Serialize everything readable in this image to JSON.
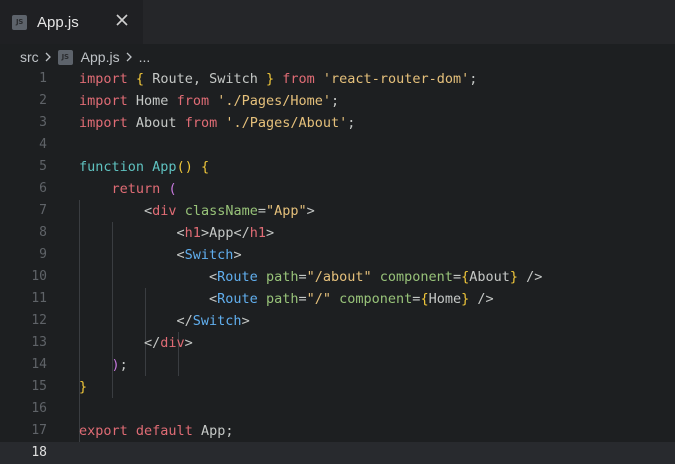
{
  "tab": {
    "title": "App.js",
    "badge": "JS"
  },
  "breadcrumb": {
    "folder": "src",
    "file": "App.js",
    "tail": "..."
  },
  "editor": {
    "current_line": 18,
    "lines": [
      {
        "n": "1",
        "tokens": [
          [
            "kw",
            "import"
          ],
          [
            "punct",
            " "
          ],
          [
            "br",
            "{"
          ],
          [
            "ident",
            " Route, Switch "
          ],
          [
            "br",
            "}"
          ],
          [
            "punct",
            " "
          ],
          [
            "kw",
            "from"
          ],
          [
            "punct",
            " "
          ],
          [
            "str",
            "'react-router-dom'"
          ],
          [
            "punct",
            ";"
          ]
        ]
      },
      {
        "n": "2",
        "tokens": [
          [
            "kw",
            "import"
          ],
          [
            "ident",
            " Home "
          ],
          [
            "kw",
            "from"
          ],
          [
            "punct",
            " "
          ],
          [
            "str",
            "'./Pages/Home'"
          ],
          [
            "punct",
            ";"
          ]
        ]
      },
      {
        "n": "3",
        "tokens": [
          [
            "kw",
            "import"
          ],
          [
            "ident",
            " About "
          ],
          [
            "kw",
            "from"
          ],
          [
            "punct",
            " "
          ],
          [
            "str",
            "'./Pages/About'"
          ],
          [
            "punct",
            ";"
          ]
        ]
      },
      {
        "n": "4",
        "tokens": []
      },
      {
        "n": "5",
        "tokens": [
          [
            "fn",
            "function"
          ],
          [
            "punct",
            " "
          ],
          [
            "fn",
            "App"
          ],
          [
            "br",
            "()"
          ],
          [
            "punct",
            " "
          ],
          [
            "br",
            "{"
          ]
        ]
      },
      {
        "n": "6",
        "tokens": [
          [
            "punct",
            "    "
          ],
          [
            "kw",
            "return"
          ],
          [
            "punct",
            " "
          ],
          [
            "br2",
            "("
          ]
        ]
      },
      {
        "n": "7",
        "tokens": [
          [
            "punct",
            "        <"
          ],
          [
            "tag",
            "div"
          ],
          [
            "punct",
            " "
          ],
          [
            "attr",
            "className"
          ],
          [
            "punct",
            "="
          ],
          [
            "str",
            "\"App\""
          ],
          [
            "punct",
            ">"
          ]
        ]
      },
      {
        "n": "8",
        "tokens": [
          [
            "punct",
            "            <"
          ],
          [
            "tag",
            "h1"
          ],
          [
            "punct",
            ">"
          ],
          [
            "ident",
            "App"
          ],
          [
            "punct",
            "</"
          ],
          [
            "tag",
            "h1"
          ],
          [
            "punct",
            ">"
          ]
        ]
      },
      {
        "n": "9",
        "tokens": [
          [
            "punct",
            "            <"
          ],
          [
            "cmp",
            "Switch"
          ],
          [
            "punct",
            ">"
          ]
        ]
      },
      {
        "n": "10",
        "tokens": [
          [
            "punct",
            "                <"
          ],
          [
            "cmp",
            "Route"
          ],
          [
            "punct",
            " "
          ],
          [
            "attr",
            "path"
          ],
          [
            "punct",
            "="
          ],
          [
            "str",
            "\"/about\""
          ],
          [
            "punct",
            " "
          ],
          [
            "attr",
            "component"
          ],
          [
            "punct",
            "="
          ],
          [
            "br",
            "{"
          ],
          [
            "ident",
            "About"
          ],
          [
            "br",
            "}"
          ],
          [
            "punct",
            " />"
          ]
        ]
      },
      {
        "n": "11",
        "tokens": [
          [
            "punct",
            "                <"
          ],
          [
            "cmp",
            "Route"
          ],
          [
            "punct",
            " "
          ],
          [
            "attr",
            "path"
          ],
          [
            "punct",
            "="
          ],
          [
            "str",
            "\"/\""
          ],
          [
            "punct",
            " "
          ],
          [
            "attr",
            "component"
          ],
          [
            "punct",
            "="
          ],
          [
            "br",
            "{"
          ],
          [
            "ident",
            "Home"
          ],
          [
            "br",
            "}"
          ],
          [
            "punct",
            " />"
          ]
        ]
      },
      {
        "n": "12",
        "tokens": [
          [
            "punct",
            "            </"
          ],
          [
            "cmp",
            "Switch"
          ],
          [
            "punct",
            ">"
          ]
        ]
      },
      {
        "n": "13",
        "tokens": [
          [
            "punct",
            "        </"
          ],
          [
            "tag",
            "div"
          ],
          [
            "punct",
            ">"
          ]
        ]
      },
      {
        "n": "14",
        "tokens": [
          [
            "punct",
            "    "
          ],
          [
            "br2",
            ")"
          ],
          [
            "punct",
            ";"
          ]
        ]
      },
      {
        "n": "15",
        "tokens": [
          [
            "br",
            "}"
          ]
        ]
      },
      {
        "n": "16",
        "tokens": []
      },
      {
        "n": "17",
        "tokens": [
          [
            "kw",
            "export"
          ],
          [
            "punct",
            " "
          ],
          [
            "kw",
            "default"
          ],
          [
            "ident",
            " App"
          ],
          [
            "punct",
            ";"
          ]
        ]
      },
      {
        "n": "18",
        "tokens": []
      }
    ]
  },
  "colors": {
    "background": "#1d1f21",
    "keyword": "#e06c75",
    "function": "#5fc2c0",
    "string": "#e5c07b",
    "component": "#61afef",
    "attribute": "#98c379",
    "bracket": "#f0c73a"
  }
}
